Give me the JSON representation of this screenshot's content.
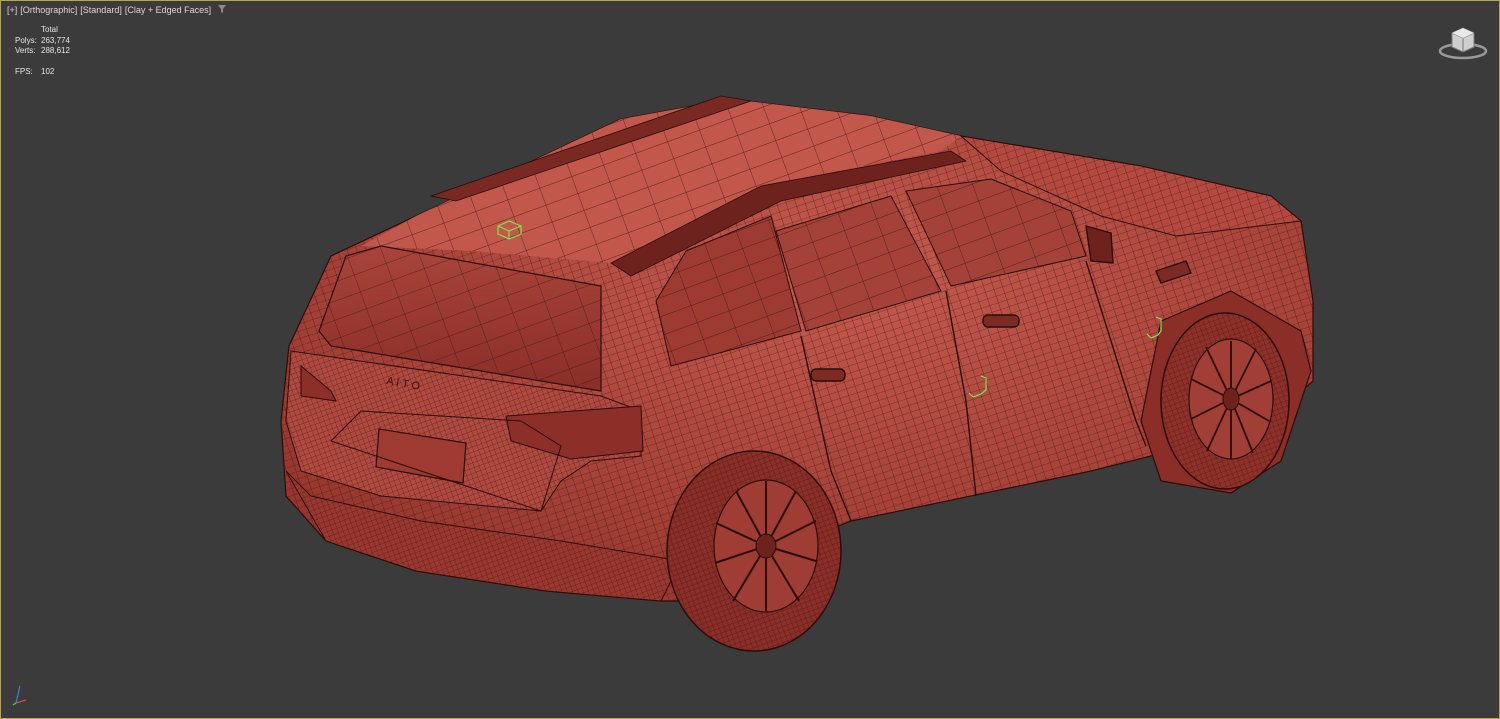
{
  "viewport": {
    "label_segments": [
      "[+]",
      "[Orthographic]",
      "[Standard]",
      "[Clay + Edged Faces]"
    ],
    "filter_icon": "funnel-icon"
  },
  "stats": {
    "header": "Total",
    "polys_label": "Polys:",
    "polys_value": "263,774",
    "verts_label": "Verts:",
    "verts_value": "288,612",
    "fps_label": "FPS:",
    "fps_value": "102"
  },
  "viewcube": {
    "icon": "viewcube-icon"
  },
  "axis_tripod": {
    "icon": "axis-tripod-icon"
  },
  "colors": {
    "background": "#3b3b3b",
    "clay": "#b5483e",
    "wire": "#3a1210",
    "selection": "#7fe64a",
    "border": "#b8a64a"
  }
}
